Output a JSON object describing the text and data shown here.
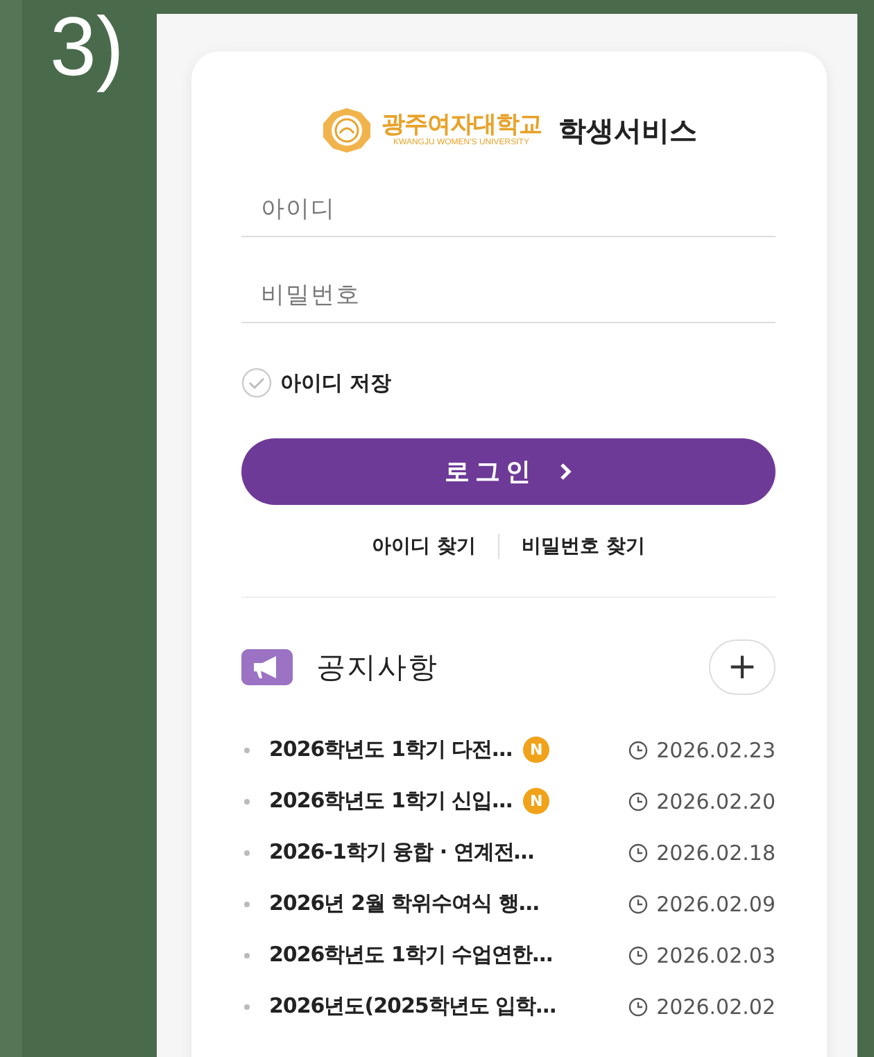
{
  "step_label": "3)",
  "logo": {
    "name": "광주여자대학교",
    "name_en": "KWANGJU WOMEN'S UNIVERSITY"
  },
  "service_title": "학생서비스",
  "id_field": {
    "placeholder": "아이디"
  },
  "password_field": {
    "placeholder": "비밀번호"
  },
  "remember_id": {
    "label": "아이디 저장",
    "checked": false
  },
  "login_button": {
    "label": "로그인"
  },
  "links": [
    "아이디 찾기",
    "비밀번호 찾기"
  ],
  "notices": {
    "title": "공지사항",
    "more_button": "+",
    "items": [
      {
        "title": "2026학년도 1학기 다전…",
        "badge": "N",
        "date": "2026.02.23"
      },
      {
        "title": "2026학년도 1학기 신입…",
        "badge": "N",
        "date": "2026.02.20"
      },
      {
        "title": "2026-1학기 융합 · 연계전…",
        "date": "2026.02.18"
      },
      {
        "title": "2026년 2월 학위수여식 행…",
        "date": "2026.02.09"
      },
      {
        "title": "2026학년도 1학기 수업연한…",
        "date": "2026.02.03"
      },
      {
        "title": "2026년도(2025학년도 입학…",
        "date": "2026.02.02"
      }
    ]
  }
}
